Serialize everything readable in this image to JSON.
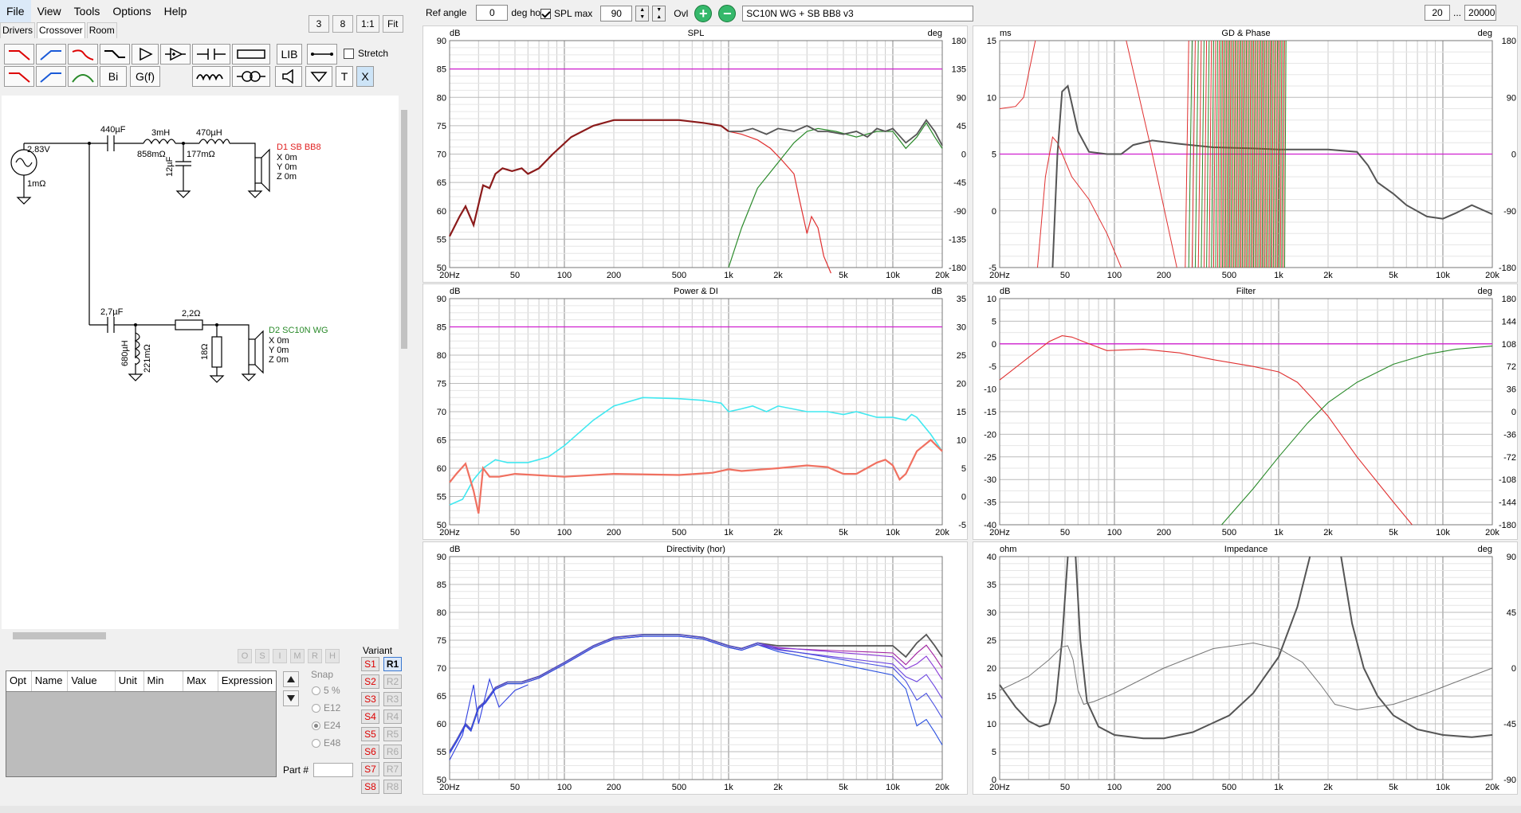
{
  "menu": [
    "File",
    "View",
    "Tools",
    "Options",
    "Help"
  ],
  "quick": [
    "3",
    "8",
    "1:1",
    "Fit"
  ],
  "tabs": [
    "Drivers",
    "Crossover",
    "Room"
  ],
  "toolbar": {
    "lib": "LIB",
    "stretch": "Stretch",
    "bi": "Bi",
    "gf": "G(f)",
    "t": "T",
    "x": "X"
  },
  "schematic": {
    "source_voltage": "2.83V",
    "source_r": "1mΩ",
    "c1": "440µF",
    "l1": "3mH",
    "l1_r": "858mΩ",
    "l2": "470µH",
    "l2_r": "177mΩ",
    "c2": "12µF",
    "d1_name": "D1 SB BB8",
    "d1_x": "X 0m",
    "d1_y": "Y 0m",
    "d1_z": "Z 0m",
    "c3": "2,7µF",
    "r1": "2,2Ω",
    "l3": "680µH",
    "l3_r": "221mΩ",
    "r2": "18Ω",
    "d2_name": "D2 SC10N WG",
    "d2_x": "X 0m",
    "d2_y": "Y 0m",
    "d2_z": "Z 0m"
  },
  "opt_buttons": [
    "O",
    "S",
    "I",
    "M",
    "R",
    "H"
  ],
  "opt_table_headers": [
    "Opt",
    "Name",
    "Value",
    "Unit",
    "Min",
    "Max",
    "Expression"
  ],
  "snap": {
    "label": "Snap",
    "options": [
      "5 %",
      "E12",
      "E24",
      "E48"
    ],
    "selected": "E24"
  },
  "part_label": "Part #",
  "variant": {
    "label": "Variant",
    "s": [
      "S1",
      "S2",
      "S3",
      "S4",
      "S5",
      "S6",
      "S7",
      "S8"
    ],
    "r": [
      "R1",
      "R2",
      "R3",
      "R4",
      "R5",
      "R6",
      "R7",
      "R8"
    ],
    "selected": "R1"
  },
  "top": {
    "ref_angle_label": "Ref angle",
    "ref_angle": "0",
    "deg_hor": "deg hor",
    "spl_max_label": "SPL max",
    "spl_max": "90",
    "ovl": "Ovl",
    "title": "SC10N WG + SB BB8 v3",
    "fmin": "20",
    "dots": "...",
    "fmax": "20000"
  },
  "freq_ticks": [
    "20Hz",
    "50",
    "100",
    "200",
    "500",
    "1k",
    "2k",
    "5k",
    "10k",
    "20k"
  ],
  "panels": {
    "spl": {
      "title": "SPL",
      "left_unit": "dB",
      "right_unit": "deg",
      "yl": [
        "90",
        "85",
        "80",
        "75",
        "70",
        "65",
        "60",
        "55",
        "50"
      ],
      "yr": [
        "180",
        "135",
        "90",
        "45",
        "0",
        "-45",
        "-90",
        "-135",
        "-180"
      ]
    },
    "gd": {
      "title": "GD & Phase",
      "left_unit": "ms",
      "right_unit": "deg",
      "yl": [
        "15",
        "10",
        "5",
        "0",
        "-5"
      ],
      "yr": [
        "180",
        "90",
        "0",
        "-90",
        "-180"
      ]
    },
    "power": {
      "title": "Power & DI",
      "left_unit": "dB",
      "right_unit": "dB",
      "yl": [
        "90",
        "85",
        "80",
        "75",
        "70",
        "65",
        "60",
        "55",
        "50"
      ],
      "yr": [
        "35",
        "30",
        "25",
        "20",
        "15",
        "10",
        "5",
        "0",
        "-5"
      ]
    },
    "filter": {
      "title": "Filter",
      "left_unit": "dB",
      "right_unit": "deg",
      "yl": [
        "10",
        "5",
        "0",
        "-5",
        "-10",
        "-15",
        "-20",
        "-25",
        "-30",
        "-35",
        "-40"
      ],
      "yr": [
        "180",
        "144",
        "108",
        "72",
        "36",
        "0",
        "-36",
        "-72",
        "-108",
        "-144",
        "-180"
      ]
    },
    "dir": {
      "title": "Directivity (hor)",
      "left_unit": "dB",
      "right_unit": "",
      "yl": [
        "90",
        "85",
        "80",
        "75",
        "70",
        "65",
        "60",
        "55",
        "50"
      ],
      "yr": []
    },
    "imp": {
      "title": "Impedance",
      "left_unit": "ohm",
      "right_unit": "deg",
      "yl": [
        "40",
        "35",
        "30",
        "25",
        "20",
        "15",
        "10",
        "5",
        "0"
      ],
      "yr": [
        "90",
        "45",
        "0",
        "-45",
        "-90"
      ]
    }
  },
  "colors": {
    "woofer": "#e03030",
    "tweeter": "#2a8a2a",
    "sum": "#555555",
    "ref": "#d020d0",
    "power": "#40e8f0",
    "di": "#f07060"
  }
}
